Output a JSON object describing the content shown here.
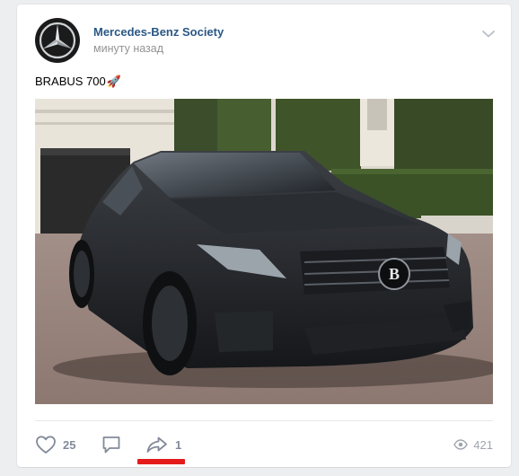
{
  "post": {
    "author": "Mercedes-Benz Society",
    "time": "минуту назад",
    "text": "BRABUS 700",
    "emoji": "🚀",
    "photo_description_icon": "car-photo"
  },
  "actions": {
    "likes": "25",
    "shares": "1",
    "views": "421"
  },
  "colors": {
    "accent": "#2a5885",
    "highlight": "#e41b1b",
    "icon": "#828a99"
  },
  "icons": [
    "mercedes-star-icon",
    "chevron-down-icon",
    "heart-icon",
    "comment-icon",
    "share-icon",
    "eye-icon"
  ]
}
